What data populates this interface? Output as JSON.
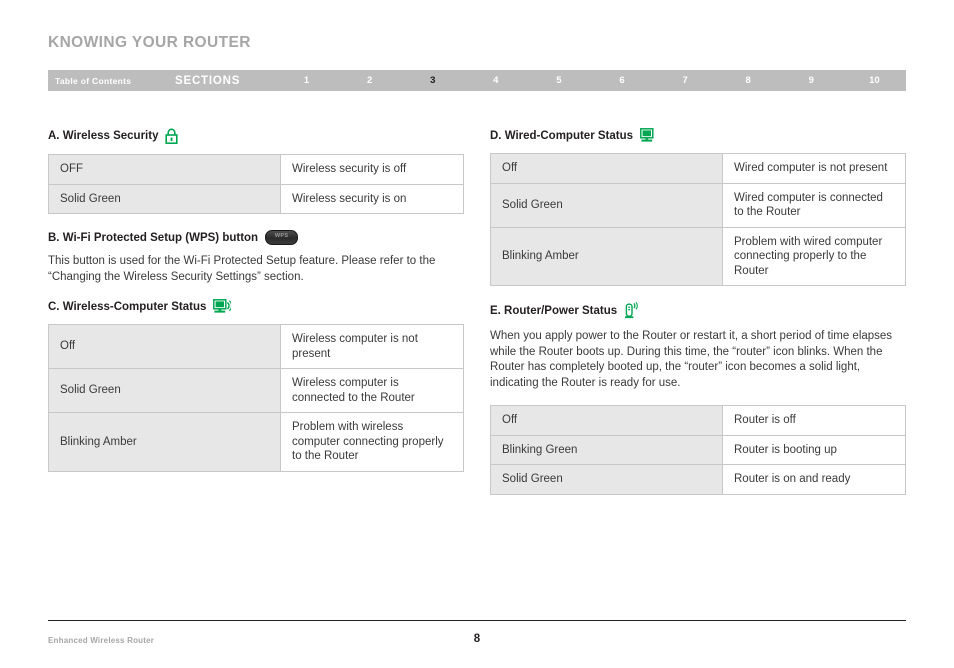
{
  "header": {
    "doc_title": "KNOWING YOUR ROUTER",
    "nav": {
      "toc_label": "Table of Contents",
      "sections_label": "SECTIONS",
      "numbers": [
        "1",
        "2",
        "3",
        "4",
        "5",
        "6",
        "7",
        "8",
        "9",
        "10"
      ],
      "active_number": "3",
      "bar_color": "#bdbdbd",
      "text_color": "#ffffff",
      "active_text_color": "#1a1a1a"
    }
  },
  "left_column": {
    "section_a": {
      "heading": "A. Wireless Security",
      "icon": "padlock-icon",
      "icon_color": "#00a651",
      "rows": [
        {
          "state": "OFF",
          "desc": "Wireless security is off"
        },
        {
          "state": "Solid Green",
          "desc": "Wireless security is on"
        }
      ]
    },
    "section_b": {
      "heading": "B. Wi-Fi Protected Setup (WPS) button",
      "button_label": "WPS",
      "paragraph": "This button is used for the Wi-Fi Protected Setup feature. Please refer to the “Changing the Wireless Security Settings” section."
    },
    "section_c": {
      "heading": "C. Wireless-Computer Status",
      "icon": "wireless-computer-icon",
      "icon_color": "#00a651",
      "rows": [
        {
          "state": "Off",
          "desc": "Wireless computer is not present"
        },
        {
          "state": "Solid Green",
          "desc": "Wireless computer is connected to the Router"
        },
        {
          "state": "Blinking Amber",
          "desc": "Problem with wireless computer connecting properly to the Router"
        }
      ]
    }
  },
  "right_column": {
    "section_d": {
      "heading": "D. Wired-Computer Status",
      "icon": "wired-computer-icon",
      "icon_color": "#00a651",
      "rows": [
        {
          "state": "Off",
          "desc": "Wired computer is not present"
        },
        {
          "state": "Solid Green",
          "desc": "Wired computer is connected to the Router"
        },
        {
          "state": "Blinking Amber",
          "desc": "Problem with wired computer connecting properly to the Router"
        }
      ]
    },
    "section_e": {
      "heading": "E. Router/Power Status",
      "icon": "router-icon",
      "icon_color": "#00a651",
      "paragraph": "When you apply power to the Router or restart it, a short period of time elapses while the Router boots up. During this time, the “router” icon blinks. When the Router has completely booted up, the “router” icon becomes a solid light, indicating the Router is ready for use.",
      "rows": [
        {
          "state": "Off",
          "desc": "Router is off"
        },
        {
          "state": "Blinking Green",
          "desc": "Router is booting up"
        },
        {
          "state": "Solid Green",
          "desc": "Router is on and ready"
        }
      ]
    }
  },
  "footer": {
    "left_text": "Enhanced Wireless Router",
    "page_number": "8"
  }
}
